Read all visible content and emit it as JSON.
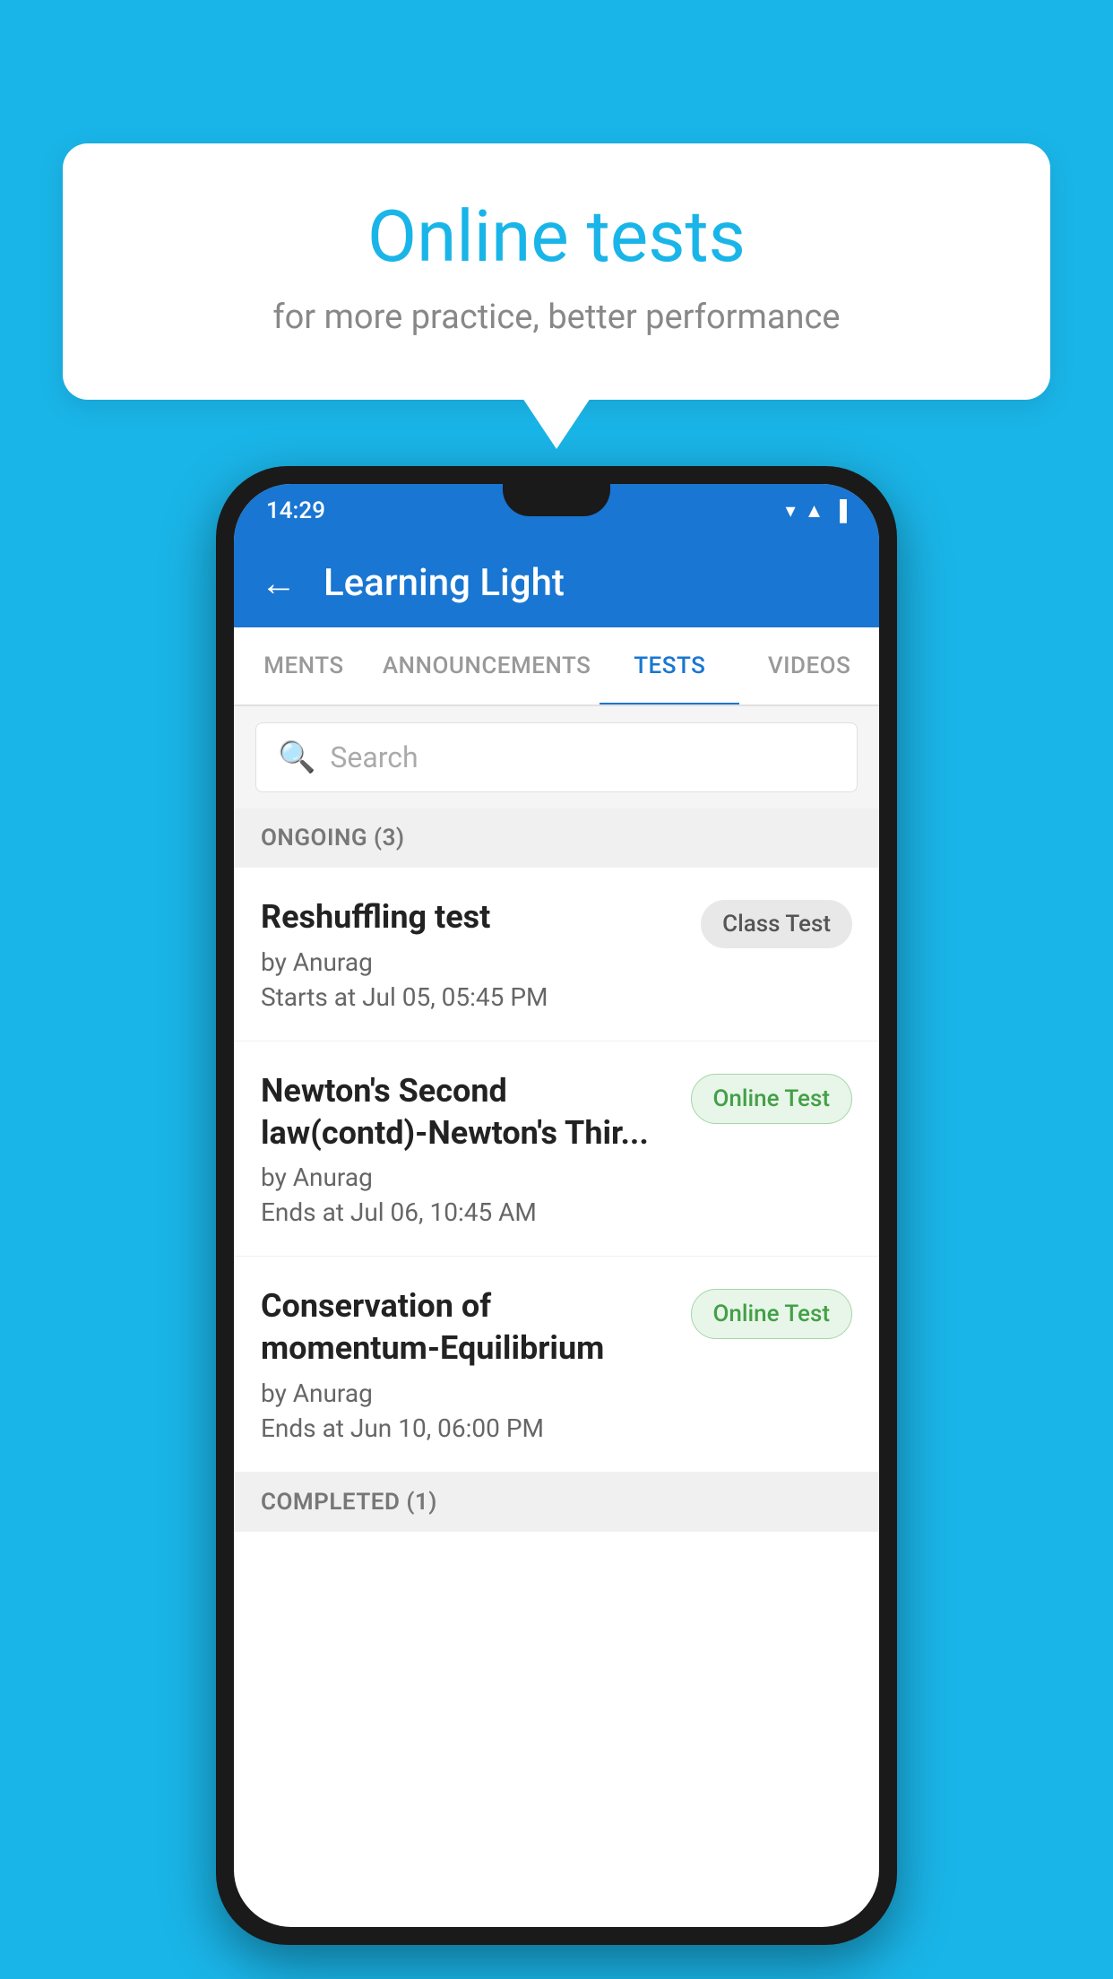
{
  "background": {
    "color": "#1ab5e8"
  },
  "speech_bubble": {
    "title": "Online tests",
    "subtitle": "for more practice, better performance"
  },
  "phone": {
    "status_bar": {
      "time": "14:29",
      "icons": [
        "wifi",
        "signal",
        "battery"
      ]
    },
    "app_bar": {
      "title": "Learning Light",
      "back_label": "←"
    },
    "tabs": [
      {
        "label": "MENTS",
        "active": false
      },
      {
        "label": "ANNOUNCEMENTS",
        "active": false
      },
      {
        "label": "TESTS",
        "active": true
      },
      {
        "label": "VIDEOS",
        "active": false
      }
    ],
    "search": {
      "placeholder": "Search"
    },
    "section_ongoing": {
      "label": "ONGOING (3)"
    },
    "tests": [
      {
        "name": "Reshuffling test",
        "author": "by Anurag",
        "date_label": "Starts at",
        "date": "Jul 05, 05:45 PM",
        "badge": "Class Test",
        "badge_type": "class"
      },
      {
        "name": "Newton's Second law(contd)-Newton's Thir...",
        "author": "by Anurag",
        "date_label": "Ends at",
        "date": "Jul 06, 10:45 AM",
        "badge": "Online Test",
        "badge_type": "online"
      },
      {
        "name": "Conservation of momentum-Equilibrium",
        "author": "by Anurag",
        "date_label": "Ends at",
        "date": "Jun 10, 06:00 PM",
        "badge": "Online Test",
        "badge_type": "online"
      }
    ],
    "section_completed": {
      "label": "COMPLETED (1)"
    }
  }
}
